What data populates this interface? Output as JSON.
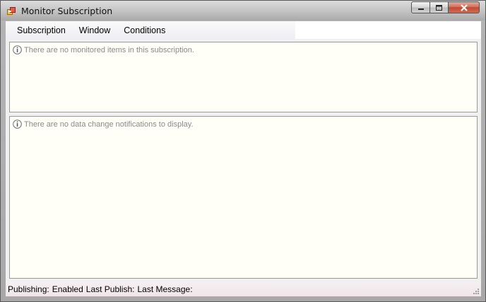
{
  "window": {
    "title": "Monitor Subscription",
    "icon": "app-window-icon",
    "controls": [
      "minimize-icon",
      "maximize-icon",
      "close-icon"
    ]
  },
  "menu": {
    "items": [
      {
        "label": "Subscription"
      },
      {
        "label": "Window"
      },
      {
        "label": "Conditions"
      }
    ]
  },
  "monitored_items": {
    "message": "There are no monitored items in this subscription.",
    "icon": "info-icon"
  },
  "notifications": {
    "message": "There are no data change notifications to display.",
    "icon": "info-icon"
  },
  "status": {
    "publishing_label": "Publishing:",
    "publishing_value": "Enabled",
    "last_publish_label": "Last Publish:",
    "last_message_label": "Last Message:"
  },
  "colors": {
    "panel_background": "#fffff8",
    "message_text": "#8a8a8a",
    "close_button": "#c04a33"
  }
}
